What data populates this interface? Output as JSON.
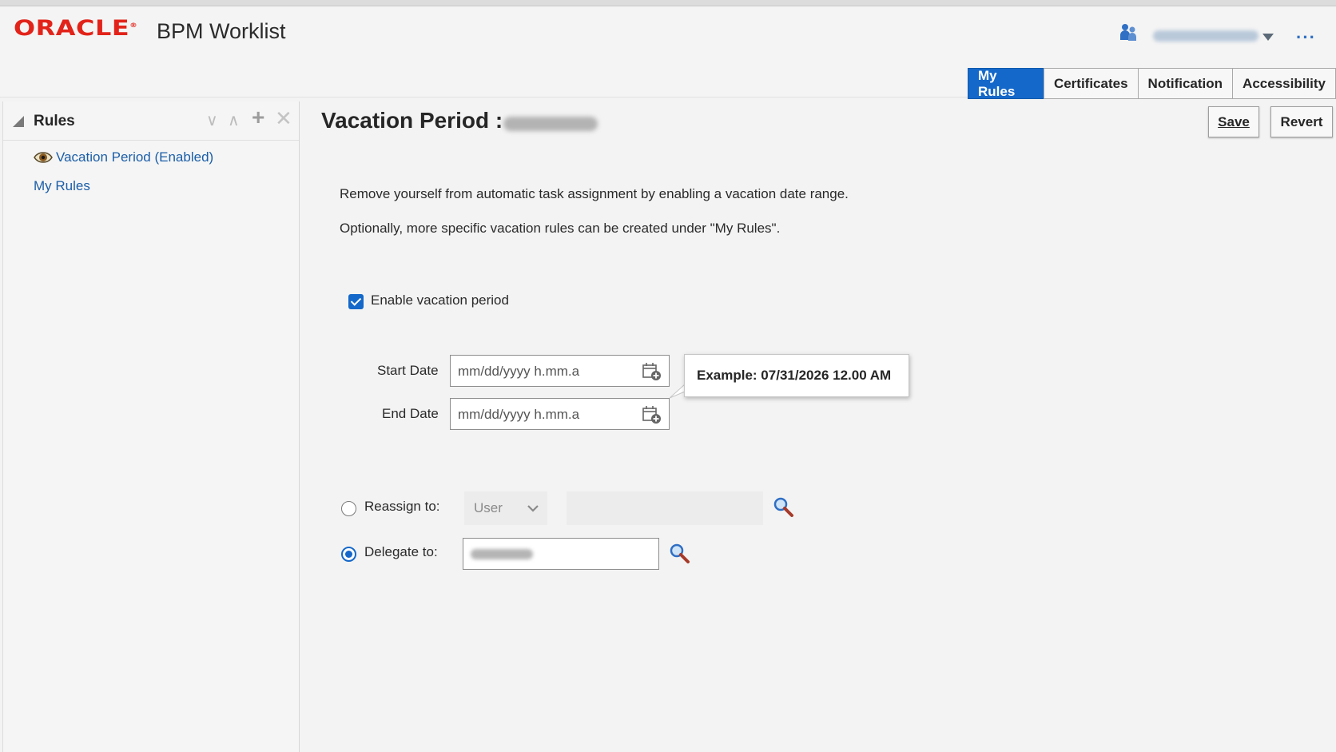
{
  "header": {
    "brand": "ORACLE",
    "app_title": "BPM Worklist",
    "more_label": "···"
  },
  "tabs": [
    {
      "label": "My Rules",
      "active": true
    },
    {
      "label": "Certificates",
      "active": false
    },
    {
      "label": "Notification",
      "active": false
    },
    {
      "label": "Accessibility",
      "active": false
    }
  ],
  "sidebar": {
    "title": "Rules",
    "items": [
      {
        "label": "Vacation Period (Enabled)",
        "icon": "eye-icon"
      },
      {
        "label": "My Rules"
      }
    ]
  },
  "main": {
    "title": "Vacation Period :",
    "save_label": "Save",
    "revert_label": "Revert",
    "description_1": "Remove yourself from automatic task assignment by enabling a vacation date range.",
    "description_2": "Optionally, more specific vacation rules can be created under \"My Rules\".",
    "enable_label": "Enable vacation period",
    "enable_checked": true,
    "start_date_label": "Start Date",
    "start_date_placeholder": "mm/dd/yyyy h.mm.a",
    "end_date_label": "End Date",
    "end_date_placeholder": "mm/dd/yyyy h.mm.a",
    "tooltip": "Example: 07/31/2026 12.00 AM",
    "reassign_label": "Reassign to:",
    "reassign_type": "User",
    "delegate_label": "Delegate to:",
    "selected_option": "delegate"
  },
  "colors": {
    "brand_red": "#e2231a",
    "accent_blue": "#1468c9",
    "link_blue": "#1b5ea8"
  }
}
